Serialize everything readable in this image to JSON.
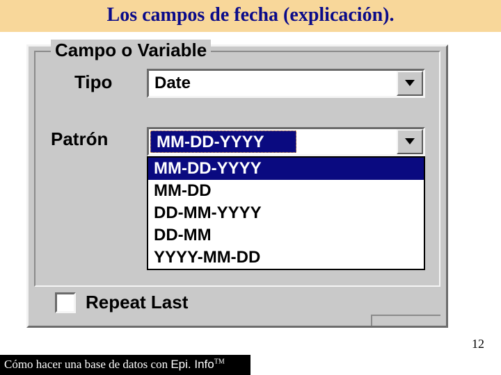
{
  "title": "Los campos de fecha (explicación).",
  "groupbox_legend": "Campo o Variable",
  "labels": {
    "tipo": "Tipo",
    "patron": "Patrón",
    "repeat": "Repeat Last"
  },
  "tipo_value": "Date",
  "patron_value": "MM-DD-YYYY",
  "patron_options": [
    "MM-DD-YYYY",
    "MM-DD",
    "DD-MM-YYYY",
    "DD-MM",
    "YYYY-MM-DD"
  ],
  "patron_selected_index": 0,
  "page_number": "12",
  "footer": {
    "prefix": "Cómo hacer una base de datos con ",
    "product": "Epi. Info",
    "tm": "TM"
  }
}
